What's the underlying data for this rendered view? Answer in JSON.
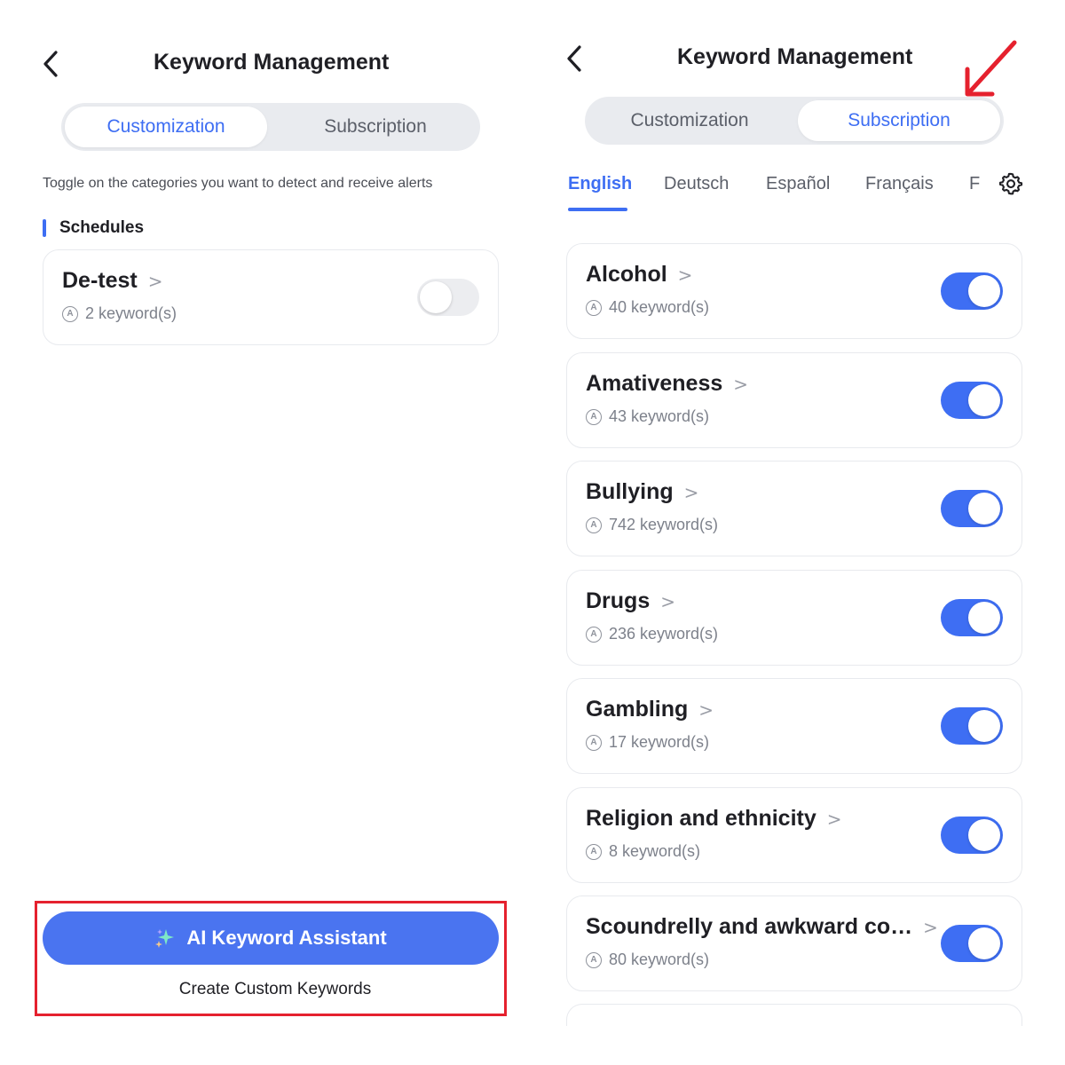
{
  "left": {
    "title": "Keyword Management",
    "tabs": [
      {
        "label": "Customization",
        "active": true
      },
      {
        "label": "Subscription",
        "active": false
      }
    ],
    "hint": "Toggle on the categories you want to detect and receive alerts",
    "section_label": "Schedules",
    "card": {
      "name": "De-test",
      "count": "2 keyword(s)",
      "enabled": false
    },
    "ai_button_label": "AI Keyword Assistant",
    "custom_link_label": "Create Custom Keywords"
  },
  "right": {
    "title": "Keyword Management",
    "tabs": [
      {
        "label": "Customization",
        "active": false
      },
      {
        "label": "Subscription",
        "active": true
      }
    ],
    "languages": [
      "English",
      "Deutsch",
      "Español",
      "Français",
      "F"
    ],
    "active_language": "English",
    "categories": [
      {
        "name": "Alcohol",
        "count": "40 keyword(s)",
        "enabled": true
      },
      {
        "name": "Amativeness",
        "count": "43 keyword(s)",
        "enabled": true
      },
      {
        "name": "Bullying",
        "count": "742 keyword(s)",
        "enabled": true
      },
      {
        "name": "Drugs",
        "count": "236 keyword(s)",
        "enabled": true
      },
      {
        "name": "Gambling",
        "count": "17 keyword(s)",
        "enabled": true
      },
      {
        "name": "Religion and ethnicity",
        "count": "8 keyword(s)",
        "enabled": true
      },
      {
        "name": "Scoundrelly and awkward co…",
        "count": "80 keyword(s)",
        "enabled": true
      }
    ]
  },
  "colors": {
    "accent": "#3e6ef3",
    "highlight": "#e5212e"
  },
  "icons": {
    "back": "chevron-left-icon",
    "settings": "gear-icon",
    "keyword": "circled-a-icon",
    "ai": "sparkle-icon",
    "pointer": "arrow-icon"
  }
}
